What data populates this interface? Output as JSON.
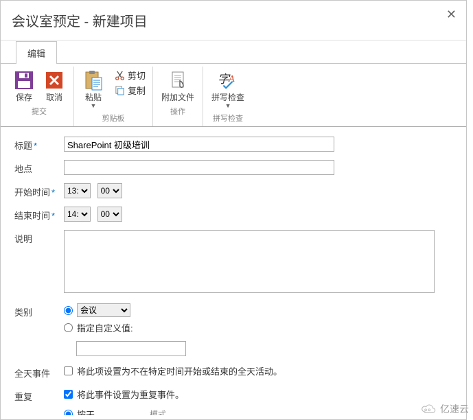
{
  "header": {
    "title": "会议室预定 - 新建项目"
  },
  "tabs": {
    "edit": "编辑"
  },
  "ribbon": {
    "save": "保存",
    "cancel": "取消",
    "paste": "粘贴",
    "cut": "剪切",
    "copy": "复制",
    "attach": "附加文件",
    "spellcheck": "拼写检查",
    "group_submit": "提交",
    "group_clipboard": "剪贴板",
    "group_actions": "操作",
    "group_spell": "拼写检查"
  },
  "form": {
    "labels": {
      "title": "标题",
      "location": "地点",
      "start": "开始时间",
      "end": "结束时间",
      "description": "说明",
      "category": "类别",
      "allday": "全天事件",
      "repeat": "重复"
    },
    "title_value": "SharePoint 初级培训",
    "location_value": "",
    "start_hour": "13:",
    "start_min": "00",
    "end_hour": "14:",
    "end_min": "00",
    "description_value": "",
    "category_option": "会议",
    "category_custom_label": "指定自定义值:",
    "allday_text": "将此项设置为不在特定时间开始或结束的全天活动。",
    "repeat_text": "将此事件设置为重复事件。",
    "repeat_mode_label": "模式",
    "repeat_daily": "按天"
  },
  "watermark": "亿速云"
}
